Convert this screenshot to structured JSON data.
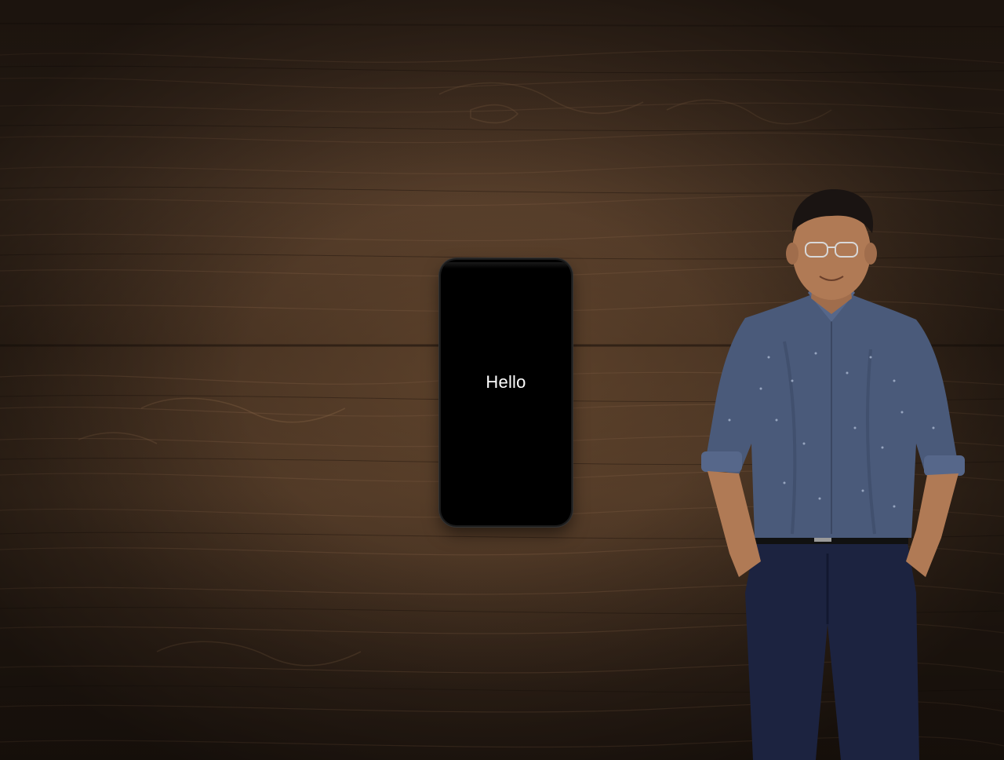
{
  "phone": {
    "screen_text": "Hello"
  },
  "colors": {
    "wood_dark": "#2f2117",
    "wood_mid": "#4b3626",
    "wood_light": "#7a5a40",
    "phone_body": "#000000",
    "phone_text": "#ffffff",
    "shirt": "#4a5a7a",
    "pants": "#1c2340",
    "skin": "#b07a55",
    "hair": "#1a1412"
  }
}
